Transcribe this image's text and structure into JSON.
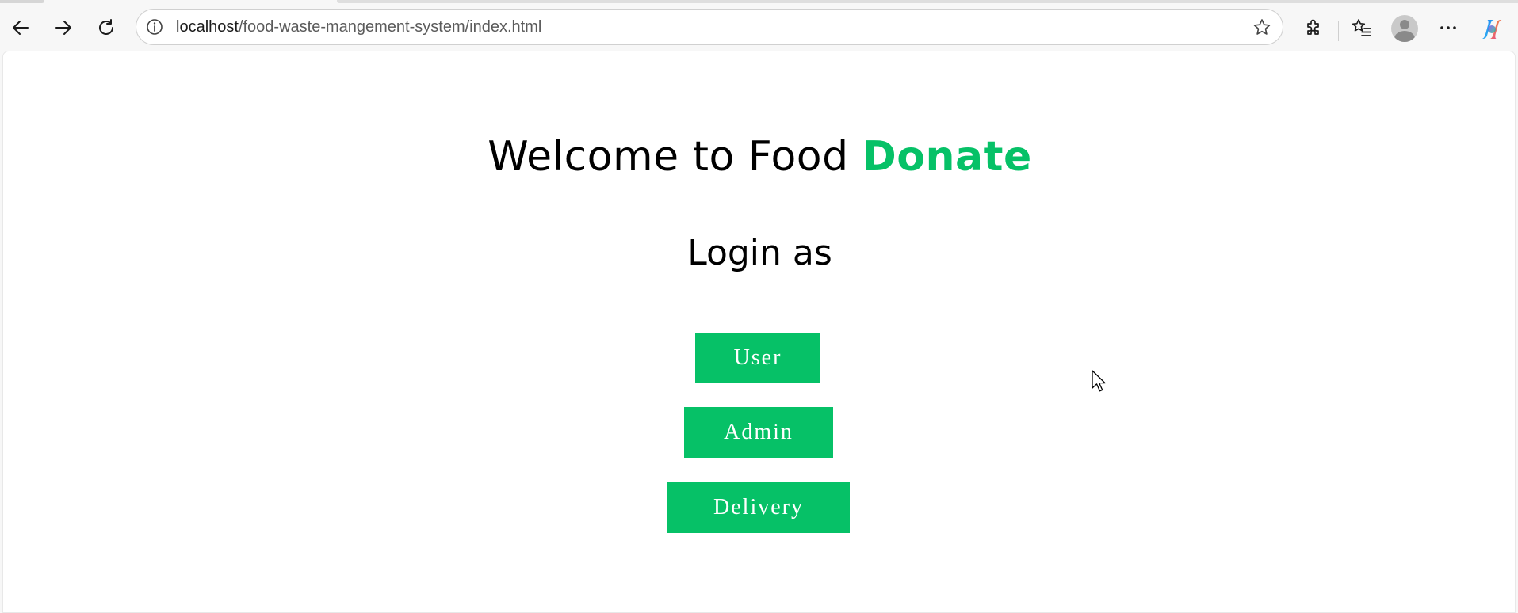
{
  "browser": {
    "url_host": "localhost",
    "url_path": "/food-waste-mangement-system/index.html",
    "icons": [
      "back-arrow-icon",
      "forward-arrow-icon",
      "refresh-icon",
      "site-info-icon",
      "favorite-star-icon",
      "extensions-icon",
      "favorites-icon",
      "profile-avatar-icon",
      "more-menu-icon",
      "copilot-icon"
    ]
  },
  "page": {
    "title_prefix": "Welcome to Food ",
    "title_accent": "Donate",
    "login_heading": "Login as",
    "buttons": {
      "user": "User",
      "admin": "Admin",
      "delivery": "Delivery"
    }
  },
  "colors": {
    "accent": "#06c167",
    "text": "#000000",
    "button_text": "#ffffff"
  }
}
